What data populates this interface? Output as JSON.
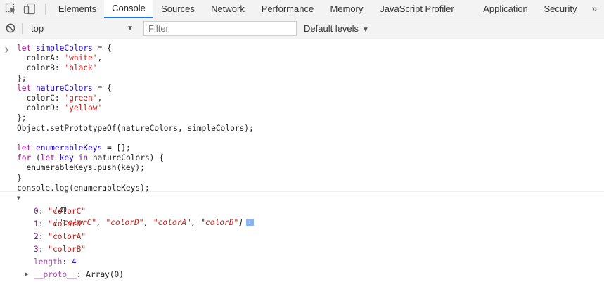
{
  "tabs": [
    {
      "label": "Elements"
    },
    {
      "label": "Console"
    },
    {
      "label": "Sources"
    },
    {
      "label": "Network"
    },
    {
      "label": "Performance"
    },
    {
      "label": "Memory"
    },
    {
      "label": "JavaScript Profiler"
    },
    {
      "label": "Application"
    },
    {
      "label": "Security"
    }
  ],
  "active_tab": "Console",
  "more_tabs_label": "»",
  "toolbar": {
    "context": "top",
    "filter_placeholder": "Filter",
    "filter_value": "",
    "levels_label": "Default levels"
  },
  "input_code": [
    "let simpleColors = {",
    "  colorA: 'white',",
    "  colorB: 'black'",
    "};",
    "let natureColors = {",
    "  colorC: 'green',",
    "  colorD: 'yellow'",
    "};",
    "Object.setPrototypeOf(natureColors, simpleColors);",
    "",
    "let enumerableKeys = [];",
    "for (let key in natureColors) {",
    "  enumerableKeys.push(key);",
    "}",
    "console.log(enumerableKeys);"
  ],
  "output": {
    "summary_count": "(4)",
    "summary_items": [
      "\"colorC\"",
      "\"colorD\"",
      "\"colorA\"",
      "\"colorB\""
    ],
    "info_badge": "i",
    "entries": [
      {
        "key": "0",
        "value": "\"colorC\""
      },
      {
        "key": "1",
        "value": "\"colorD\""
      },
      {
        "key": "2",
        "value": "\"colorA\""
      },
      {
        "key": "3",
        "value": "\"colorB\""
      }
    ],
    "length_key": "length",
    "length_value": "4",
    "proto_key": "__proto__",
    "proto_value": "Array(0)"
  },
  "colors": {
    "accent": "#1a73e8",
    "keyword": "#aa0d91",
    "string": "#c41a16",
    "number": "#1c00cf",
    "property": "#881391"
  },
  "icons": {
    "inspect": "inspect-element-icon",
    "device": "device-toolbar-icon",
    "clear": "clear-console-icon"
  }
}
